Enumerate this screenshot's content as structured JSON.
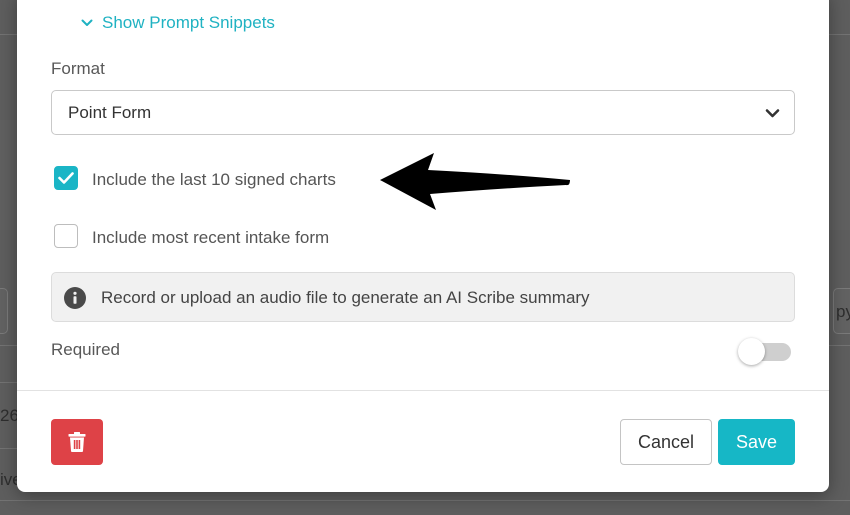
{
  "modal": {
    "snippets_link_label": "Show Prompt Snippets",
    "format_label": "Format",
    "format_selected": "Point Form",
    "checkbox_charts": {
      "label": "Include the last 10 signed charts",
      "checked": true
    },
    "checkbox_intake": {
      "label": "Include most recent intake form",
      "checked": false
    },
    "info_text": "Record or upload an audio file to generate an AI Scribe summary",
    "required_label": "Required",
    "required_on": false,
    "cancel_label": "Cancel",
    "save_label": "Save"
  },
  "background": {
    "left_number_fragment": "26",
    "left_text_fragment": "ive",
    "right_text_fragment": "py l"
  },
  "colors": {
    "accent": "#1ab5c6",
    "danger": "#de4247",
    "overlay": "#5e5e5e"
  }
}
